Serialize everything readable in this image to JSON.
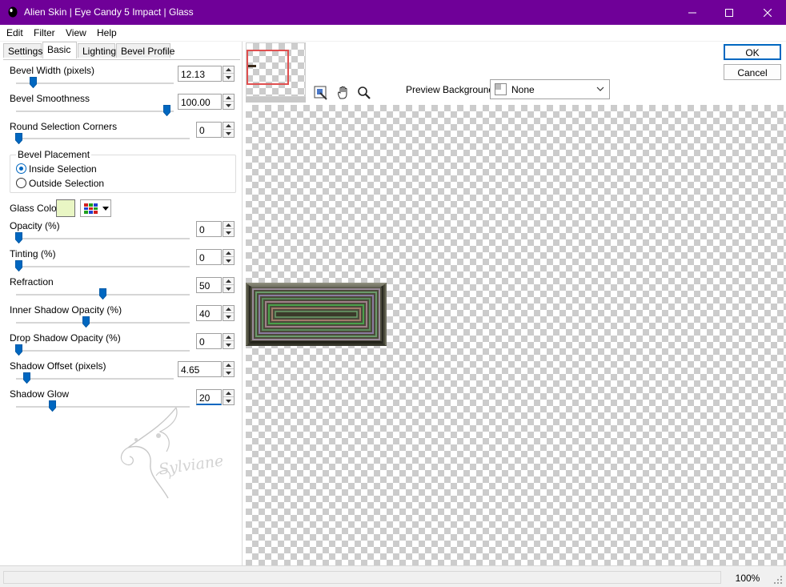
{
  "window": {
    "title": "Alien Skin | Eye Candy 5 Impact | Glass",
    "titlebar_color": "#6f0098"
  },
  "menu": [
    "Edit",
    "Filter",
    "View",
    "Help"
  ],
  "tabs": [
    {
      "label": "Settings",
      "active": false
    },
    {
      "label": "Basic",
      "active": true
    },
    {
      "label": "Lighting",
      "active": false
    },
    {
      "label": "Bevel Profile",
      "active": false
    }
  ],
  "controls": {
    "bevel_width": {
      "label": "Bevel Width (pixels)",
      "value": "12.13",
      "slider_fraction": 0.09
    },
    "bevel_smoothness": {
      "label": "Bevel Smoothness",
      "value": "100.00",
      "slider_fraction": 1.0
    },
    "round_corners": {
      "label": "Round Selection Corners",
      "value": "0",
      "slider_fraction": 0.0
    },
    "bevel_placement": {
      "label": "Bevel Placement",
      "options": [
        {
          "label": "Inside Selection",
          "checked": true
        },
        {
          "label": "Outside Selection",
          "checked": false
        }
      ]
    },
    "glass_color": {
      "label": "Glass Color",
      "color": "#e9f6c4",
      "icon": "color-grid-icon"
    },
    "opacity": {
      "label": "Opacity (%)",
      "value": "0",
      "slider_fraction": 0.0
    },
    "tinting": {
      "label": "Tinting (%)",
      "value": "0",
      "slider_fraction": 0.0
    },
    "refraction": {
      "label": "Refraction",
      "value": "50",
      "slider_fraction": 0.5
    },
    "inner_shadow_opacity": {
      "label": "Inner Shadow Opacity (%)",
      "value": "40",
      "slider_fraction": 0.4
    },
    "drop_shadow_opacity": {
      "label": "Drop Shadow Opacity (%)",
      "value": "0",
      "slider_fraction": 0.0
    },
    "shadow_offset": {
      "label": "Shadow Offset (pixels)",
      "value": "4.65",
      "slider_fraction": 0.05
    },
    "shadow_glow": {
      "label": "Shadow Glow",
      "value": "20",
      "slider_fraction": 0.2
    }
  },
  "watermark_text": "Sylviane",
  "buttons": {
    "ok": "OK",
    "cancel": "Cancel"
  },
  "preview": {
    "background_label": "Preview Background:",
    "background_value": "None",
    "tools": [
      "navigator-icon",
      "hand-icon",
      "zoom-icon"
    ]
  },
  "status": {
    "zoom": "100%"
  }
}
